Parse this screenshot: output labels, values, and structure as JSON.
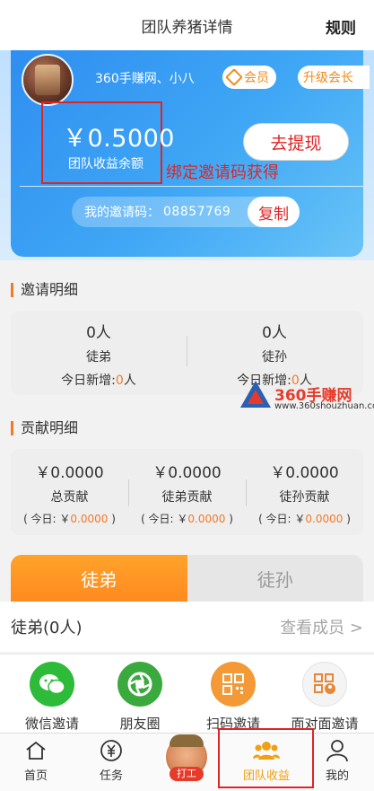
{
  "header": {
    "title": "团队养猪详情",
    "rule_label": "规则"
  },
  "profile": {
    "username": "360手赚网、小八",
    "member_badge": "会员",
    "upgrade_badge": "升级会长"
  },
  "balance": {
    "value": "￥0.5000",
    "label": "团队收益余额",
    "withdraw_label": "去提现",
    "bind_note": "绑定邀请码获得"
  },
  "invite": {
    "label": "我的邀请码：",
    "code": "08857769",
    "copy_label": "复制"
  },
  "invite_details": {
    "title": "邀请明细",
    "apprentice": {
      "count": "0人",
      "label": "徒弟",
      "today_prefix": "今日新增:",
      "today_value": "0",
      "today_suffix": "人"
    },
    "grand_apprentice": {
      "count": "0人",
      "label": "徒孙",
      "today_prefix": "今日新增:",
      "today_value": "0",
      "today_suffix": "人"
    }
  },
  "watermark": {
    "brand": "360手赚网",
    "url": "www.360shouzhuan.com"
  },
  "contribution": {
    "title": "贡献明细",
    "items": [
      {
        "value": "￥0.0000",
        "label": "总贡献",
        "today_prefix": "( 今日: ￥",
        "today_value": "0.0000",
        "today_suffix": " )"
      },
      {
        "value": "￥0.0000",
        "label": "徒弟贡献",
        "today_prefix": "( 今日: ￥",
        "today_value": "0.0000",
        "today_suffix": " )"
      },
      {
        "value": "￥0.0000",
        "label": "徒孙贡献",
        "today_prefix": "( 今日: ￥",
        "today_value": "0.0000",
        "today_suffix": " )"
      }
    ]
  },
  "tabs": [
    {
      "label": "徒弟",
      "active": true
    },
    {
      "label": "徒孙",
      "active": false
    }
  ],
  "members": {
    "left": "徒弟(0人)",
    "right": "查看成员 >"
  },
  "share": [
    {
      "label": "微信邀请",
      "icon": "wechat-icon",
      "color": "#2dbb39"
    },
    {
      "label": "朋友圈",
      "icon": "moments-icon",
      "color": "#3aa93e"
    },
    {
      "label": "扫码邀请",
      "icon": "qrcode-icon",
      "color": "#f39a37"
    },
    {
      "label": "面对面邀请",
      "icon": "face-to-face-icon",
      "color": "#f4f4f4"
    }
  ],
  "nav": {
    "home": "首页",
    "tasks": "任务",
    "center_tag": "打工",
    "team_income": "团队收益",
    "mine": "我的"
  },
  "colors": {
    "accent_orange": "#f07a2a",
    "highlight_red": "#e02424",
    "card_blue": "#2f8ef0"
  }
}
